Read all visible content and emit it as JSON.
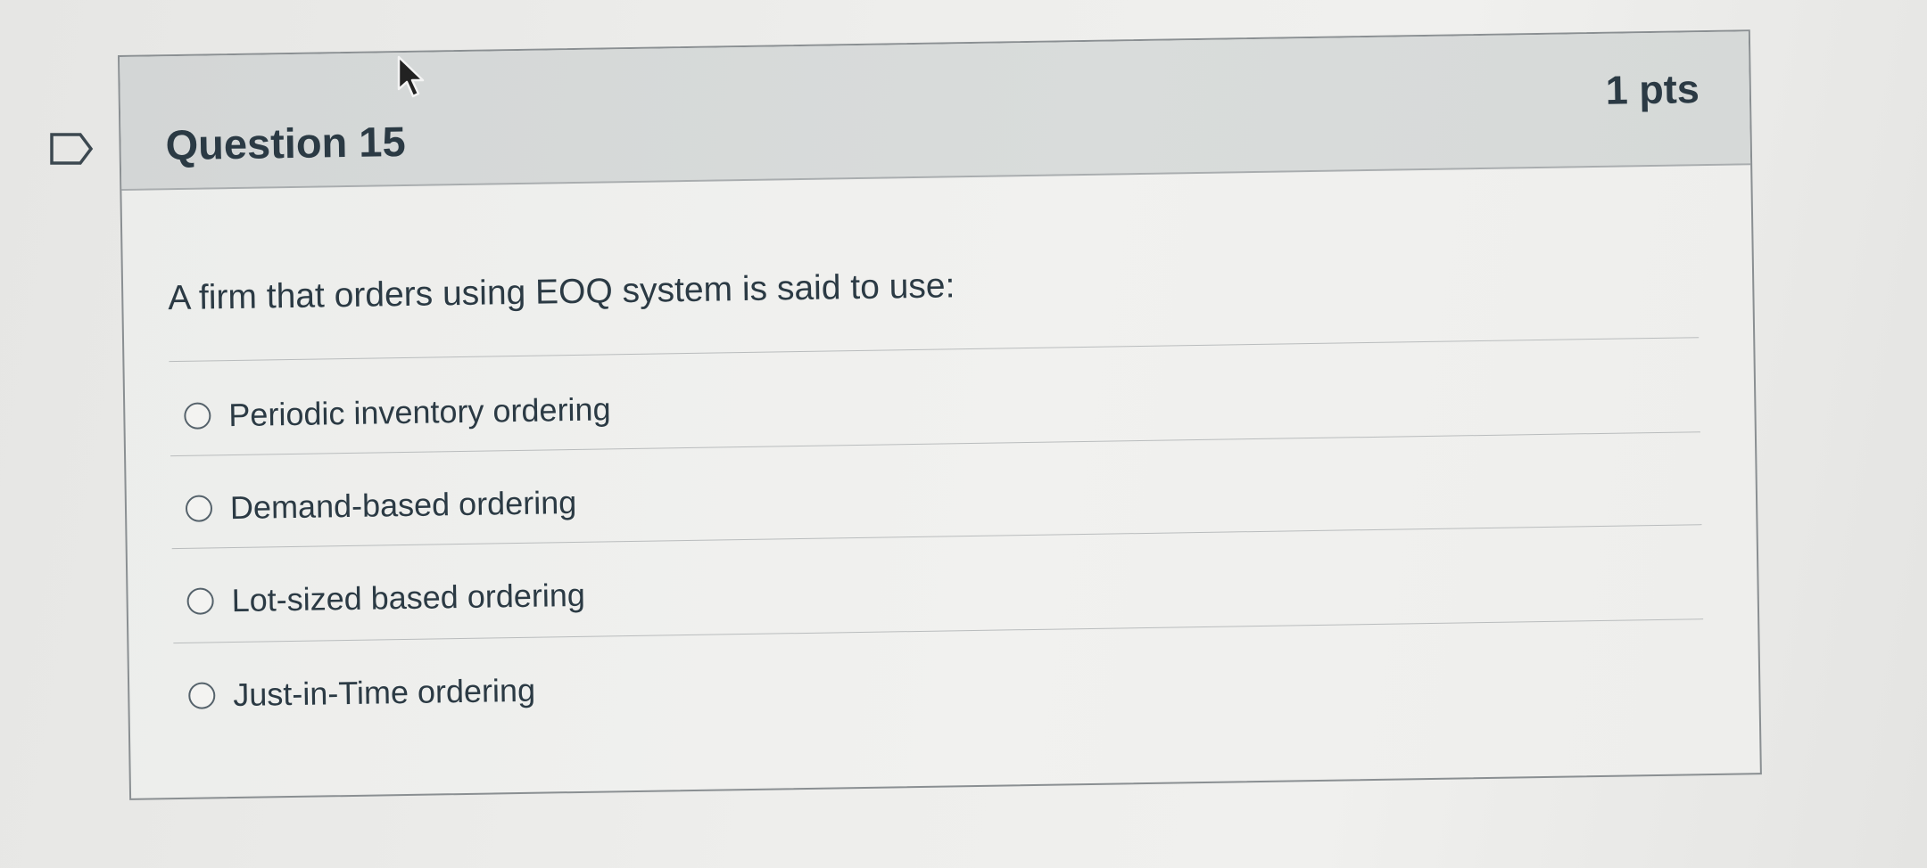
{
  "question": {
    "title": "Question 15",
    "points": "1 pts",
    "text": "A firm that orders using EOQ system is said to use:",
    "answers": [
      {
        "label": "Periodic inventory ordering",
        "selected": false
      },
      {
        "label": "Demand-based ordering",
        "selected": false
      },
      {
        "label": "Lot-sized based ordering",
        "selected": false
      },
      {
        "label": "Just-in-Time ordering",
        "selected": false
      }
    ]
  },
  "icons": {
    "flag": "flag-question-icon",
    "cursor": "mouse-pointer-icon",
    "radio": "radio-unchecked-icon"
  },
  "colors": {
    "header_bg": "#d6d9d8",
    "body_bg": "#efefed",
    "text": "#2b3a44",
    "border": "#8a8f92"
  }
}
